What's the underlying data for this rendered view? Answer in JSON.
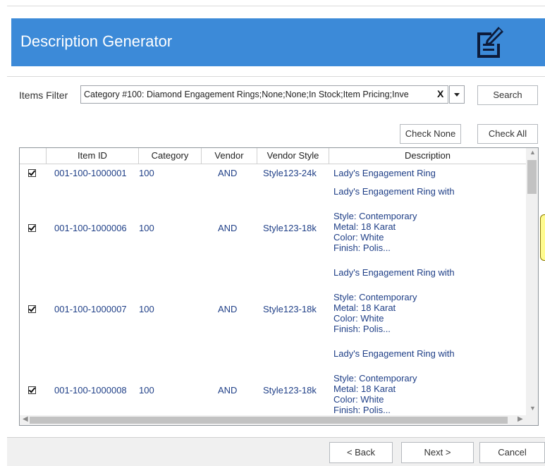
{
  "header": {
    "title": "Description Generator",
    "icon": "edit-document-icon",
    "background": "#3c8ad8"
  },
  "filter": {
    "label": "Items Filter",
    "value": "Category #100: Diamond Engagement Rings;None;None;In Stock;Item Pricing;Inve",
    "clear_glyph": "X"
  },
  "buttons": {
    "search": "Search",
    "check_none": "Check None",
    "check_all": "Check All",
    "back": "< Back",
    "next": "Next >",
    "cancel": "Cancel"
  },
  "table": {
    "columns": [
      "Item ID",
      "Category",
      "Vendor",
      "Vendor Style",
      "Description"
    ],
    "rows": [
      {
        "checked": true,
        "item_id": "001-100-1000001",
        "category": "100",
        "vendor": "AND",
        "vendor_style": "Style123-24k",
        "desc_title": "Lady's Engagement Ring",
        "desc_lines": []
      },
      {
        "checked": true,
        "item_id": "001-100-1000006",
        "category": "100",
        "vendor": "AND",
        "vendor_style": "Style123-18k",
        "desc_title": "Lady's Engagement Ring with",
        "desc_lines": [
          "Style: Contemporary",
          "Metal: 18 Karat",
          "Color: White",
          "Finish: Polis..."
        ]
      },
      {
        "checked": true,
        "item_id": "001-100-1000007",
        "category": "100",
        "vendor": "AND",
        "vendor_style": "Style123-18k",
        "desc_title": "Lady's Engagement Ring with",
        "desc_lines": [
          "Style: Contemporary",
          "Metal: 18 Karat",
          "Color: White",
          "Finish: Polis..."
        ]
      },
      {
        "checked": true,
        "item_id": "001-100-1000008",
        "category": "100",
        "vendor": "AND",
        "vendor_style": "Style123-18k",
        "desc_title": "Lady's Engagement Ring with",
        "desc_lines": [
          "Style: Contemporary",
          "Metal: 18 Karat",
          "Color: White",
          "Finish: Polis..."
        ]
      }
    ]
  }
}
